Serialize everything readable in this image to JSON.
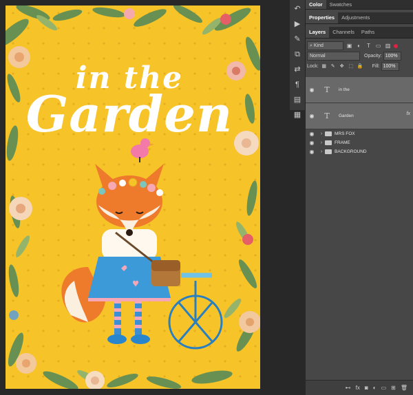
{
  "artwork": {
    "title_small": "in the",
    "title_big": "Garden"
  },
  "tools": [
    "history-icon",
    "play-icon",
    "brush-settings-icon",
    "clone-icon",
    "properties-icon",
    "paragraph-icon",
    "libraries-icon",
    "notes-icon"
  ],
  "panel_tabs_top": [
    {
      "label": "Color",
      "active": true
    },
    {
      "label": "Swatches",
      "active": false
    }
  ],
  "panel_tabs_mid": [
    {
      "label": "Properties",
      "active": true
    },
    {
      "label": "Adjustments",
      "active": false
    }
  ],
  "panel_tabs_layers": [
    {
      "label": "Layers",
      "active": true
    },
    {
      "label": "Channels",
      "active": false
    },
    {
      "label": "Paths",
      "active": false
    }
  ],
  "layers_panel": {
    "filter_kind": "Kind",
    "blend_mode": "Normal",
    "opacity_label": "Opacity:",
    "opacity_value": "100%",
    "lock_label": "Lock:",
    "fill_label": "Fill:",
    "fill_value": "100%"
  },
  "layers": [
    {
      "name": "in the",
      "type": "text",
      "fx": ""
    },
    {
      "name": "Garden",
      "type": "text",
      "fx": "fx"
    },
    {
      "name": "MRS FOX",
      "type": "group"
    },
    {
      "name": "FRAME",
      "type": "group"
    },
    {
      "name": "BACKGROUND",
      "type": "group"
    }
  ],
  "colors": {
    "artboard_yellow": "#f6c329",
    "panel_bg": "#474747",
    "selected_layer": "#696969"
  }
}
